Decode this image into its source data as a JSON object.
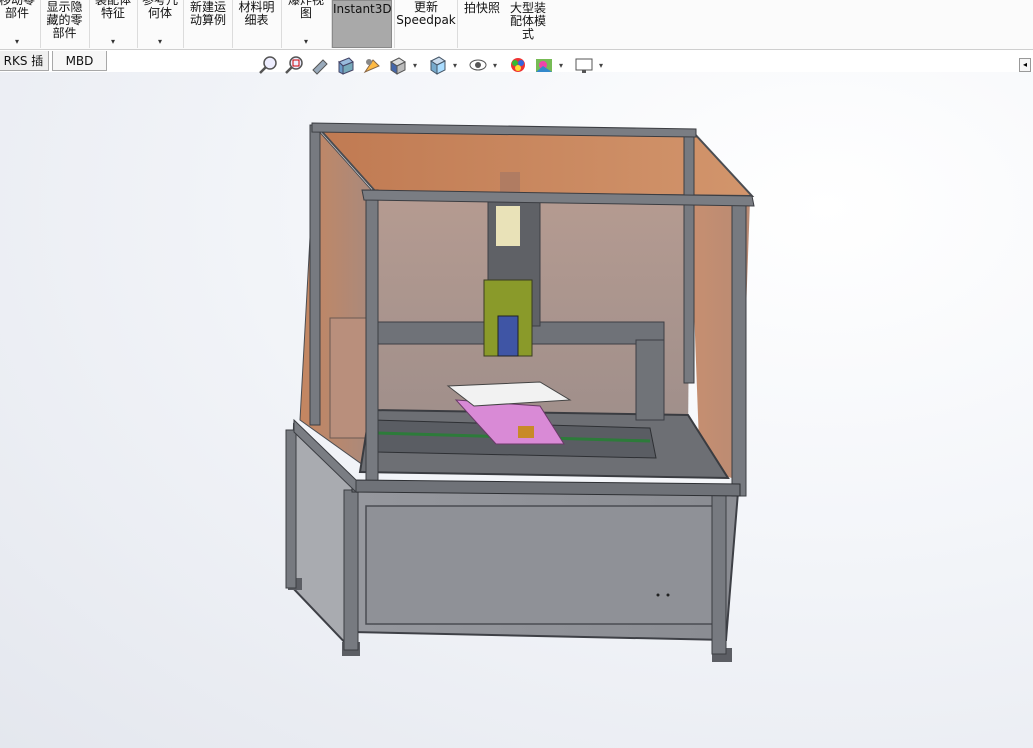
{
  "ribbon": {
    "buttons": [
      {
        "label": "移动零\n部件",
        "dropdown": true
      },
      {
        "label": "显示隐\n藏的零\n部件",
        "dropdown": false
      },
      {
        "label": "装配体\n特征",
        "dropdown": true
      },
      {
        "label": "参考几\n何体",
        "dropdown": true
      },
      {
        "label": "新建运\n动算例",
        "dropdown": false
      },
      {
        "label": "材料明\n细表",
        "dropdown": false
      },
      {
        "label": "爆炸视\n图",
        "dropdown": true
      },
      {
        "label": "Instant3D",
        "dropdown": false,
        "active": true
      },
      {
        "label": "更新\nSpeedpak",
        "dropdown": false
      },
      {
        "label": "拍快照",
        "dropdown": false
      },
      {
        "label": "大型装\n配体模\n式",
        "dropdown": false
      }
    ],
    "arrow": "▾"
  },
  "tabs": [
    {
      "label": "RKS 插件"
    },
    {
      "label": "MBD"
    }
  ],
  "view_toolbar": {
    "icons": [
      "zoom-to-fit-icon",
      "zoom-to-area-icon",
      "previous-view-icon",
      "section-view-icon",
      "dynamic-annotation-icon",
      "view-orientation-icon",
      "display-style-icon",
      "hide-show-items-icon",
      "edit-appearance-icon",
      "apply-scene-icon",
      "view-settings-icon"
    ],
    "arrow": "▾"
  },
  "colors": {
    "frame": "#6e7178",
    "panel_glass": "#c88a66",
    "base_panel": "#9a9ca2",
    "carriage": "#d98ad6",
    "spindle": "#8a9a2a",
    "accent": "#a9a9a9"
  },
  "model": {
    "name": "CNC machine assembly"
  }
}
